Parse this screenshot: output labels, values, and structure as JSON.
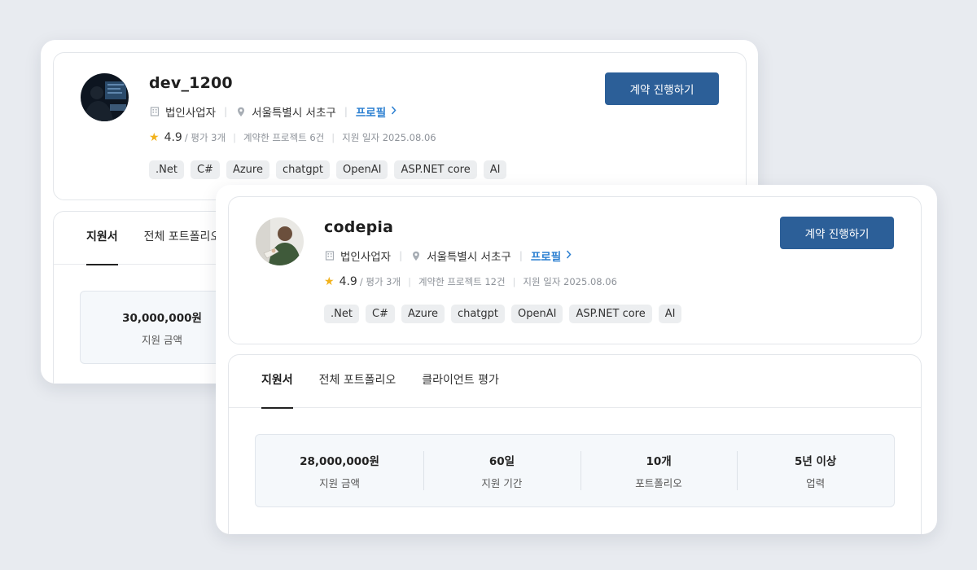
{
  "cards": [
    {
      "username": "dev_1200",
      "biz_type": "법인사업자",
      "location": "서울특별시 서초구",
      "profile_link": "프로필",
      "rating": "4.9",
      "reviews": "/ 평가 3개",
      "projects": "계약한 프로젝트 6건",
      "apply_date": "지원 일자 2025.08.06",
      "tags": [
        ".Net",
        "C#",
        "Azure",
        "chatgpt",
        "OpenAI",
        "ASP.NET core",
        "AI"
      ],
      "contract_button": "계약 진행하기",
      "tabs": [
        "지원서",
        "전체 포트폴리오"
      ],
      "summary": [
        {
          "value": "30,000,000원",
          "label": "지원 금액"
        }
      ]
    },
    {
      "username": "codepia",
      "biz_type": "법인사업자",
      "location": "서울특별시 서초구",
      "profile_link": "프로필",
      "rating": "4.9",
      "reviews": "/ 평가 3개",
      "projects": "계약한 프로젝트 12건",
      "apply_date": "지원 일자 2025.08.06",
      "tags": [
        ".Net",
        "C#",
        "Azure",
        "chatgpt",
        "OpenAI",
        "ASP.NET core",
        "AI"
      ],
      "contract_button": "계약 진행하기",
      "tabs": [
        "지원서",
        "전체 포트폴리오",
        "클라이언트 평가"
      ],
      "summary": [
        {
          "value": "28,000,000원",
          "label": "지원 금액"
        },
        {
          "value": "60일",
          "label": "지원 기간"
        },
        {
          "value": "10개",
          "label": "포트폴리오"
        },
        {
          "value": "5년 이상",
          "label": "업력"
        }
      ]
    }
  ],
  "colors": {
    "primary_button": "#2c5f98",
    "profile_link": "#2b7fd1",
    "star": "#f2b21b",
    "background": "#e8ebf0"
  },
  "icons": {
    "building": "building-icon",
    "pin": "map-pin-icon",
    "star": "star-icon",
    "chevron": "chevron-right-icon"
  }
}
